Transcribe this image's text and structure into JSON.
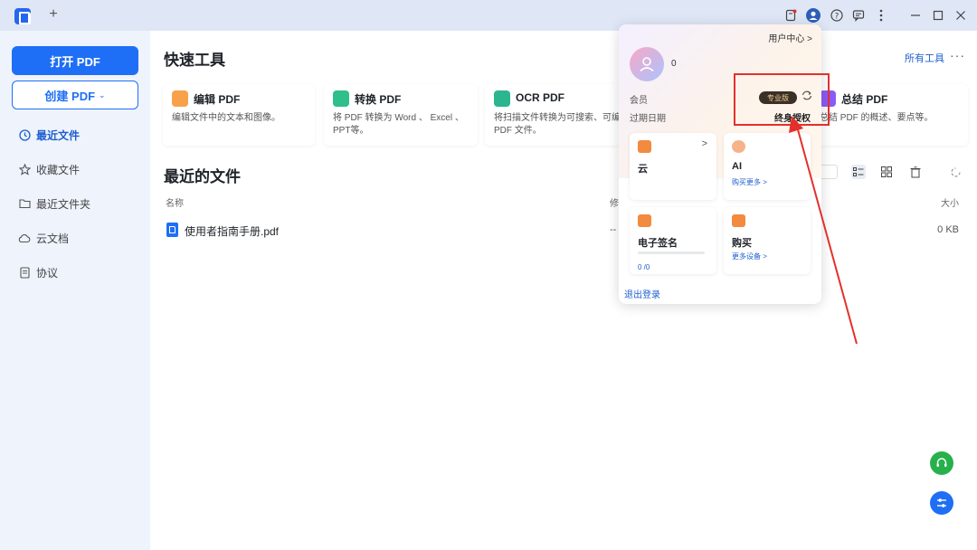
{
  "titlebar": {
    "new_tab": "+",
    "icons": [
      "notification-icon",
      "user-avatar-icon",
      "help-icon",
      "feedback-icon",
      "more-vertical-icon",
      "minimize-icon",
      "maximize-icon",
      "close-icon"
    ]
  },
  "sidebar": {
    "open_pdf": "打开 PDF",
    "create_pdf": "创建 PDF",
    "items": [
      {
        "label": "最近文件",
        "icon": "clock-icon",
        "active": true
      },
      {
        "label": "收藏文件",
        "icon": "star-icon",
        "active": false
      },
      {
        "label": "最近文件夹",
        "icon": "folder-icon",
        "active": false
      },
      {
        "label": "云文档",
        "icon": "cloud-icon",
        "active": false
      },
      {
        "label": "协议",
        "icon": "document-icon",
        "active": false
      }
    ]
  },
  "quick_tools": {
    "title": "快速工具",
    "all_tools": "所有工具",
    "more": "···",
    "cards": [
      {
        "name": "编辑 PDF",
        "desc": "编辑文件中的文本和图像。",
        "color": "#f7a24a",
        "icon": "edit-pdf-icon"
      },
      {
        "name": "转换 PDF",
        "desc": "将 PDF 转换为 Word 、 Excel 、 PPT等。",
        "color": "#2fbf8a",
        "icon": "convert-pdf-icon"
      },
      {
        "name": "OCR PDF",
        "desc": "将扫描文件转换为可搜索、可编辑 的 PDF 文件。",
        "color": "#2bb68f",
        "icon": "ocr-pdf-icon"
      },
      {
        "name": "总结 PDF",
        "desc": "总结 PDF 的概述、要点等。",
        "color": "#8a5cf6",
        "icon": "summarize-pdf-icon"
      }
    ]
  },
  "recent": {
    "title": "最近的文件",
    "columns": {
      "name": "名称",
      "modified": "修",
      "size": "大小"
    },
    "files": [
      {
        "name": "使用者指南手册.pdf",
        "modified": "--",
        "size": "0 KB"
      }
    ]
  },
  "popup": {
    "user_center": "用户中心 >",
    "count": "0",
    "member_label": "会员",
    "member_badge": "专业版",
    "expire_label": "过期日期",
    "expire_value": "终身授权",
    "cards": {
      "cloud": {
        "name": "云",
        "arrow": ">"
      },
      "ai": {
        "name": "AI",
        "link": "购买更多 >"
      },
      "esign": {
        "name": "电子签名",
        "count": "0 /0"
      },
      "buy": {
        "name": "购买",
        "link": "更多设备 >"
      }
    },
    "logout": "退出登录"
  },
  "colors": {
    "accent": "#1e6ff5",
    "sidebar_bg": "#eef3fc",
    "titlebar_bg": "#dfe7f6",
    "annotation": "#e4302b",
    "support_green": "#27b14c"
  }
}
